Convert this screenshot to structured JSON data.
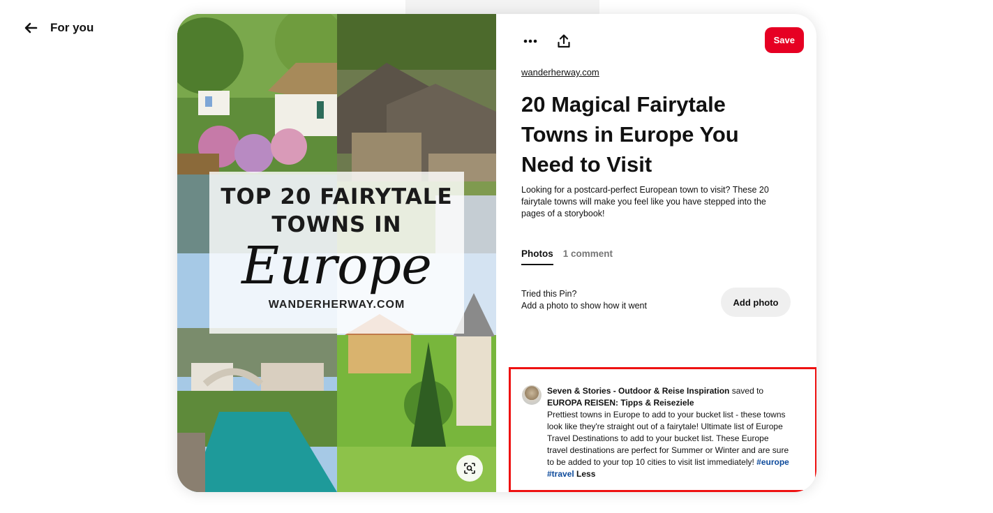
{
  "nav": {
    "back_label": "For you"
  },
  "pin_image": {
    "overlay_line1": "TOP 20 FAIRYTALE",
    "overlay_line2": "TOWNS IN",
    "overlay_script": "Europe",
    "overlay_site": "WANDERHERWAY.COM"
  },
  "toolbar": {
    "save_label": "Save"
  },
  "pin": {
    "source": "wanderherway.com",
    "title": "20 Magical Fairytale Towns in Europe You Need to Visit",
    "description": "Looking for a postcard-perfect European town to visit? These 20 fairytale towns will make you feel like you have stepped into the pages of a storybook!"
  },
  "tabs": [
    {
      "label": "Photos",
      "active": true
    },
    {
      "label": "1 comment",
      "active": false
    }
  ],
  "tried": {
    "line1": "Tried this Pin?",
    "line2": "Add a photo to show how it went",
    "button_label": "Add photo"
  },
  "saved": {
    "user": "Seven & Stories - Outdoor & Reise Inspiration",
    "saved_to": "saved to",
    "board": "EUROPA REISEN: Tipps & Reiseziele",
    "text": "Prettiest towns in Europe to add to your bucket list - these towns look like they're straight out of a fairytale! Ultimate list of Europe Travel Destinations to add to your bucket list. These Europe travel destinations are perfect for Summer or Winter and are sure to be added to your top 10 cities to visit list immediately!",
    "tag1": "#europe",
    "tag2": "#travel",
    "less": "Less"
  },
  "colors": {
    "save": "#e60023",
    "highlight_border": "#ee1111",
    "hashtag": "#0d4a9b"
  }
}
